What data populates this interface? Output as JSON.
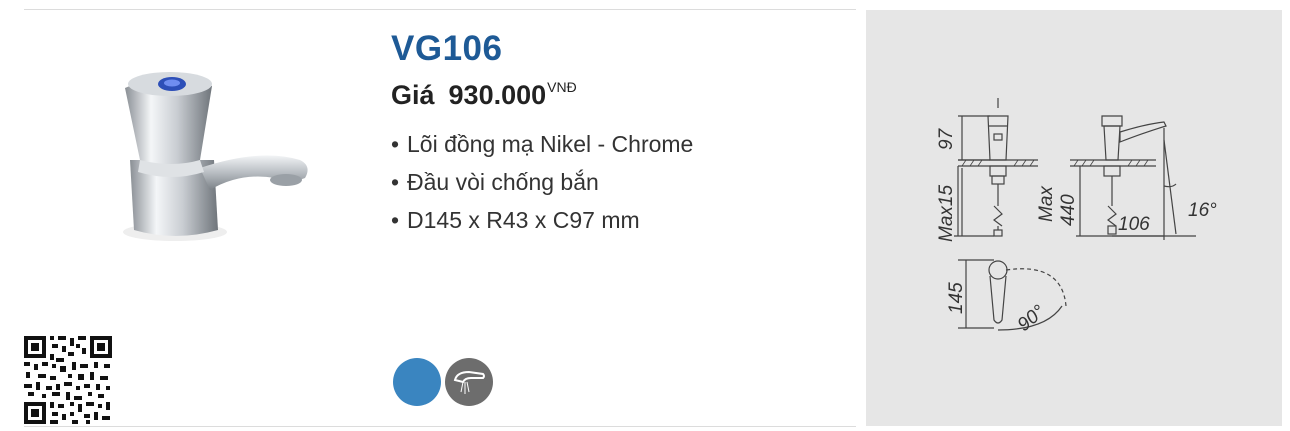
{
  "product": {
    "model": "VG106",
    "price_label": "Giá",
    "price_value": "930.000",
    "currency": "VNĐ",
    "features": [
      "Lõi đồng mạ Nikel - Chrome",
      "Đầu vòi chống bắn",
      "D145 x R43 x C97 mm"
    ]
  },
  "swatches": [
    {
      "name": "blue",
      "color": "#3a85c0"
    },
    {
      "name": "aerator-feature",
      "color": "#6d6d6d"
    }
  ],
  "drawing": {
    "front_height": "97",
    "front_max": "Max15",
    "side_max_label": "Max",
    "side_max_value": "440",
    "side_reach": "106",
    "side_angle": "16°",
    "top_length": "145",
    "top_angle": "90°"
  }
}
